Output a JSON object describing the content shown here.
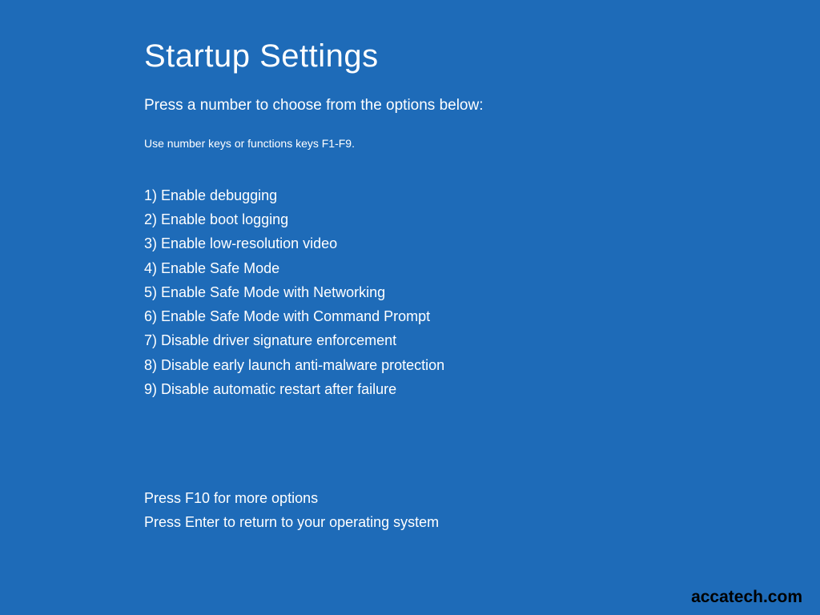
{
  "title": "Startup Settings",
  "instruction": "Press a number to choose from the options below:",
  "hint": "Use number keys or functions keys F1-F9.",
  "options": [
    "1) Enable debugging",
    "2) Enable boot logging",
    "3) Enable low-resolution video",
    "4) Enable Safe Mode",
    "5) Enable Safe Mode with Networking",
    "6) Enable Safe Mode with Command Prompt",
    "7) Disable driver signature enforcement",
    "8) Disable early launch anti-malware protection",
    "9) Disable automatic restart after failure"
  ],
  "footer": {
    "moreOptions": "Press F10 for more options",
    "returnOption": "Press Enter to return to your operating system"
  },
  "watermark": "accatech.com"
}
